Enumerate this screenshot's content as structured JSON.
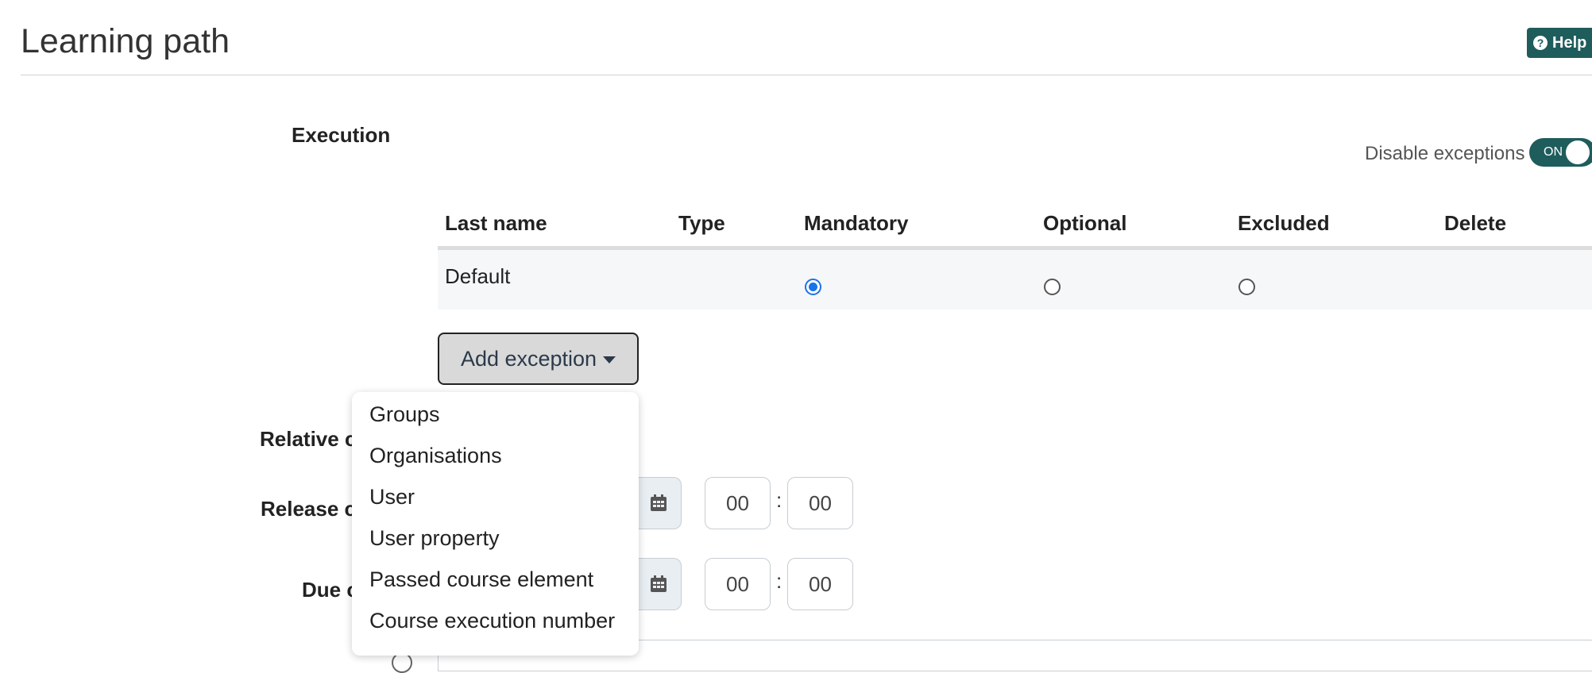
{
  "page": {
    "title": "Learning path",
    "help_label": "Help"
  },
  "execution": {
    "label": "Execution",
    "disable_exceptions_label": "Disable exceptions",
    "toggle_state": "ON",
    "table": {
      "columns": [
        "Last name",
        "Type",
        "Mandatory",
        "Optional",
        "Excluded",
        "Delete"
      ],
      "rows": [
        {
          "last_name": "Default",
          "selected": "Mandatory"
        }
      ]
    },
    "add_exception_label": "Add exception",
    "add_exception_menu": [
      "Groups",
      "Organisations",
      "User",
      "User property",
      "Passed course element",
      "Course execution number"
    ]
  },
  "fields": {
    "relative_label_visible": "Relative c",
    "release_label_visible": "Release c",
    "due_label_visible": "Due c",
    "release_time": {
      "hours": "00",
      "minutes": "00"
    },
    "due_time": {
      "hours": "00",
      "minutes": "00"
    }
  }
}
